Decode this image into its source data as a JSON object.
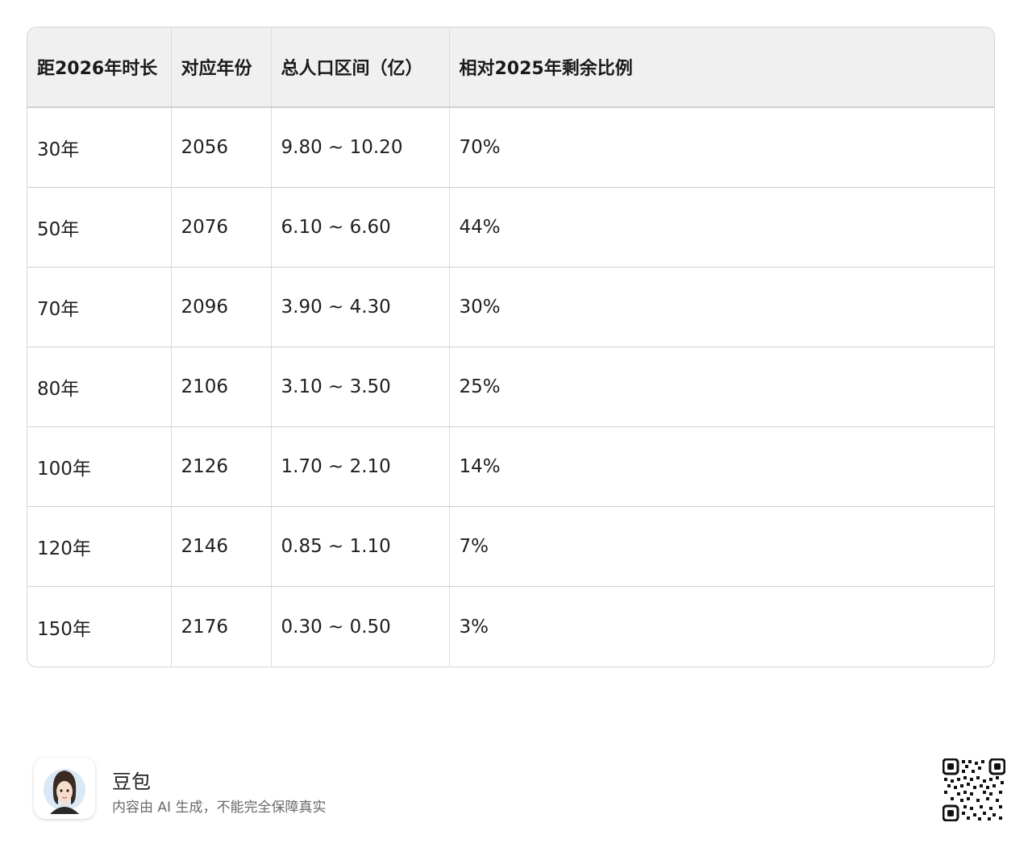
{
  "table": {
    "headers": [
      "距2026年时长",
      "对应年份",
      "总人口区间（亿）",
      "相对2025年剩余比例"
    ],
    "rows": [
      [
        "30年",
        "2056",
        "9.80 ~ 10.20",
        "70%"
      ],
      [
        "50年",
        "2076",
        "6.10 ~ 6.60",
        "44%"
      ],
      [
        "70年",
        "2096",
        "3.90 ~ 4.30",
        "30%"
      ],
      [
        "80年",
        "2106",
        "3.10 ~ 3.50",
        "25%"
      ],
      [
        "100年",
        "2126",
        "1.70 ~ 2.10",
        "14%"
      ],
      [
        "120年",
        "2146",
        "0.85 ~ 1.10",
        "7%"
      ],
      [
        "150年",
        "2176",
        "0.30 ~ 0.50",
        "3%"
      ]
    ]
  },
  "footer": {
    "brand_name": "豆包",
    "disclaimer": "内容由 AI 生成，不能完全保障真实",
    "avatar_icon": "avatar-icon",
    "qr_icon": "qr-code-icon"
  }
}
